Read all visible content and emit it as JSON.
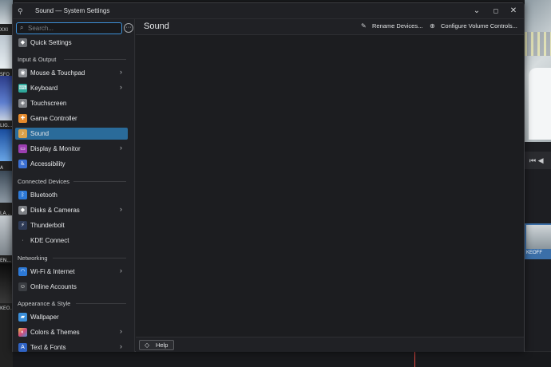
{
  "window": {
    "title": "Sound — System Settings",
    "minimize_glyph": "⌄",
    "maximize_glyph": "◻",
    "close_glyph": "✕"
  },
  "search": {
    "placeholder": "Search...",
    "value": ""
  },
  "sidebar": {
    "quick_settings": {
      "label": "Quick Settings",
      "icon": "quick-settings-icon"
    },
    "sections": [
      {
        "title": "Input & Output",
        "items": [
          {
            "label": "Mouse & Touchpad",
            "icon": "mouse-icon",
            "has_submenu": true
          },
          {
            "label": "Keyboard",
            "icon": "keyboard-icon",
            "has_submenu": true
          },
          {
            "label": "Touchscreen",
            "icon": "touchscreen-icon",
            "has_submenu": false
          },
          {
            "label": "Game Controller",
            "icon": "game-controller-icon",
            "has_submenu": false
          },
          {
            "label": "Sound",
            "icon": "sound-icon",
            "has_submenu": false,
            "selected": true
          },
          {
            "label": "Display & Monitor",
            "icon": "display-icon",
            "has_submenu": true
          },
          {
            "label": "Accessibility",
            "icon": "accessibility-icon",
            "has_submenu": false
          }
        ]
      },
      {
        "title": "Connected Devices",
        "items": [
          {
            "label": "Bluetooth",
            "icon": "bluetooth-icon",
            "has_submenu": false
          },
          {
            "label": "Disks & Cameras",
            "icon": "disks-icon",
            "has_submenu": true
          },
          {
            "label": "Thunderbolt",
            "icon": "thunderbolt-icon",
            "has_submenu": false
          },
          {
            "label": "KDE Connect",
            "icon": "kde-connect-icon",
            "has_submenu": false
          }
        ]
      },
      {
        "title": "Networking",
        "items": [
          {
            "label": "Wi-Fi & Internet",
            "icon": "wifi-icon",
            "has_submenu": true
          },
          {
            "label": "Online Accounts",
            "icon": "online-accounts-icon",
            "has_submenu": false
          }
        ]
      },
      {
        "title": "Appearance & Style",
        "items": [
          {
            "label": "Wallpaper",
            "icon": "wallpaper-icon",
            "has_submenu": false
          },
          {
            "label": "Colors & Themes",
            "icon": "colors-icon",
            "has_submenu": true
          },
          {
            "label": "Text & Fonts",
            "icon": "fonts-icon",
            "has_submenu": true
          }
        ]
      }
    ]
  },
  "main": {
    "title": "Sound",
    "rename_devices_label": "Rename Devices...",
    "configure_volume_label": "Configure Volume Controls...",
    "help_label": "Help"
  },
  "background": {
    "thumb_labels": [
      "XXI",
      "SFO",
      "LIG...",
      "A",
      "LA...",
      "EN...",
      "KEO..."
    ],
    "clip_label": "KEOFF"
  },
  "colors": {
    "accent": "#3d8fd6",
    "selected_item": "#2a6b9a",
    "window_bg": "#1f2023",
    "content_bg": "#1c1d20"
  }
}
